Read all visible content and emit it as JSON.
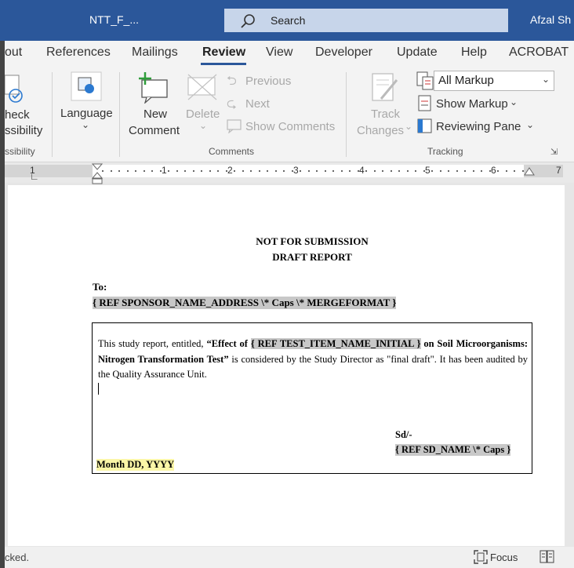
{
  "titlebar": {
    "doc_title": "NTT_F_...",
    "search_label": "Search",
    "user_name": "Afzal Sh"
  },
  "tabs": [
    "out",
    "References",
    "Mailings",
    "Review",
    "View",
    "Developer",
    "Update",
    "Help",
    "ACROBAT"
  ],
  "active_tab": "Review",
  "ribbon": {
    "accessibility": {
      "line1": "heck",
      "line2": "ssibility",
      "group": "ssibility"
    },
    "language": {
      "label": "Language"
    },
    "comments": {
      "new_line1": "New",
      "new_line2": "Comment",
      "delete_label": "Delete",
      "previous": "Previous",
      "next": "Next",
      "show_comments": "Show Comments",
      "group": "Comments"
    },
    "tracking": {
      "track_line1": "Track",
      "track_line2": "Changes",
      "markup_value": "All Markup",
      "show_markup": "Show Markup",
      "reviewing_pane": "Reviewing Pane",
      "group": "Tracking"
    }
  },
  "ruler": {
    "numbers": [
      "1",
      "1",
      "2",
      "3",
      "4",
      "5",
      "6",
      "7"
    ]
  },
  "document": {
    "heading1": "NOT FOR SUBMISSION",
    "heading2": "DRAFT REPORT",
    "to_label": "To:",
    "sponsor_field": "{ REF  SPONSOR_NAME_ADDRESS \\* Caps  \\* MERGEFORMAT }",
    "para_start": "This study report, entitled, ",
    "para_bold1": "“Effect of ",
    "para_field": "{ REF    TEST_ITEM_NAME_INITIAL  }",
    "para_bold2": " on Soil Microorganisms: Nitrogen Transformation Test”",
    "para_end": " is considered by the Study Director as \"final draft\". It has been audited by the Quality Assurance Unit.",
    "sd_label": "Sd/-",
    "sd_field": "{ REF  SD_NAME \\* Caps }",
    "date_field": "Month DD, YYYY"
  },
  "statusbar": {
    "left_text": "cked.",
    "focus_label": "Focus"
  },
  "colors": {
    "titlebar": "#2b579a",
    "search_box": "#c7d5ea",
    "field_shading": "#c8c8c8",
    "date_highlight": "#fbf6a7"
  }
}
